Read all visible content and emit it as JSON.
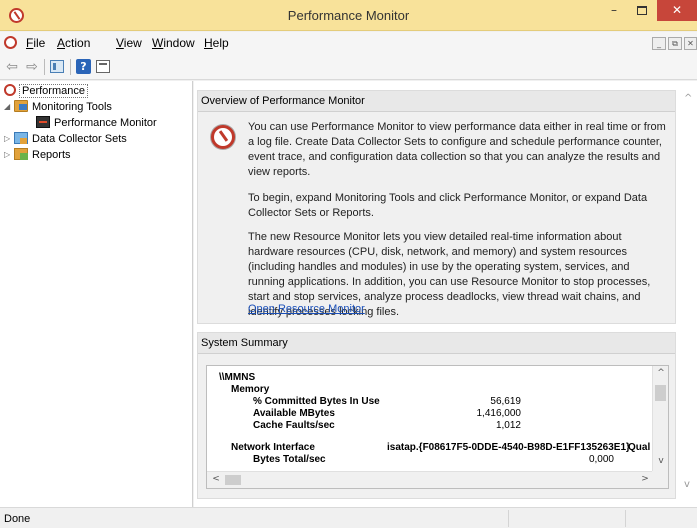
{
  "window": {
    "title": "Performance Monitor",
    "minimize": "–",
    "close": "✕"
  },
  "menu": {
    "items": [
      {
        "acc": "F",
        "rest": "ile"
      },
      {
        "acc": "A",
        "rest": "ction"
      },
      {
        "acc": "V",
        "rest": "iew"
      },
      {
        "acc": "W",
        "rest": "indow"
      },
      {
        "acc": "H",
        "rest": "elp"
      }
    ],
    "mdi": [
      "_",
      "⧉",
      "✕"
    ]
  },
  "toolbar": {
    "back": "⇦",
    "forward": "⇨",
    "help": "?"
  },
  "tree": {
    "root": "Performance",
    "monitoring_tools": "Monitoring Tools",
    "performance_monitor": "Performance Monitor",
    "data_collector_sets": "Data Collector Sets",
    "reports": "Reports",
    "expanded_arrow": "◢",
    "collapsed_arrow": "▷"
  },
  "overview": {
    "header": "Overview of Performance Monitor",
    "p1": "You can use Performance Monitor to view performance data either in real time or from a log file. Create Data Collector Sets to configure and schedule performance counter, event trace, and configuration data collection so that you can analyze the results and view reports.",
    "p2": "To begin, expand Monitoring Tools and click Performance Monitor, or expand Data Collector Sets or Reports.",
    "p3": "The new Resource Monitor lets you view detailed real-time information about hardware resources (CPU, disk, network, and memory) and system resources (including handles and modules) in use by the operating system, services, and running applications. In addition, you can use Resource Monitor to stop processes, start and stop services, analyze process deadlocks, view thread wait chains, and identify processes locking files.",
    "link": "Open Resource Monitor"
  },
  "summary": {
    "header": "System Summary",
    "machine": "\\\\MMNS",
    "memory": {
      "label": "Memory",
      "counters": [
        {
          "name": "% Committed Bytes In Use",
          "value": "56,619"
        },
        {
          "name": "Available MBytes",
          "value": "1,416,000"
        },
        {
          "name": "Cache Faults/sec",
          "value": "1,012"
        }
      ]
    },
    "network": {
      "label": "Network Interface",
      "instance": "isatap.{F08617F5-0DDE-4540-B98D-E1FF135263E1}",
      "instance2": "Qual",
      "counter": "Bytes Total/sec",
      "value": "0,000"
    },
    "scroll_up": "^",
    "scroll_down": "v",
    "scroll_left": "<",
    "scroll_right": ">"
  },
  "outer_scroll": {
    "up": "^",
    "down": "v"
  },
  "status": {
    "text": "Done"
  }
}
